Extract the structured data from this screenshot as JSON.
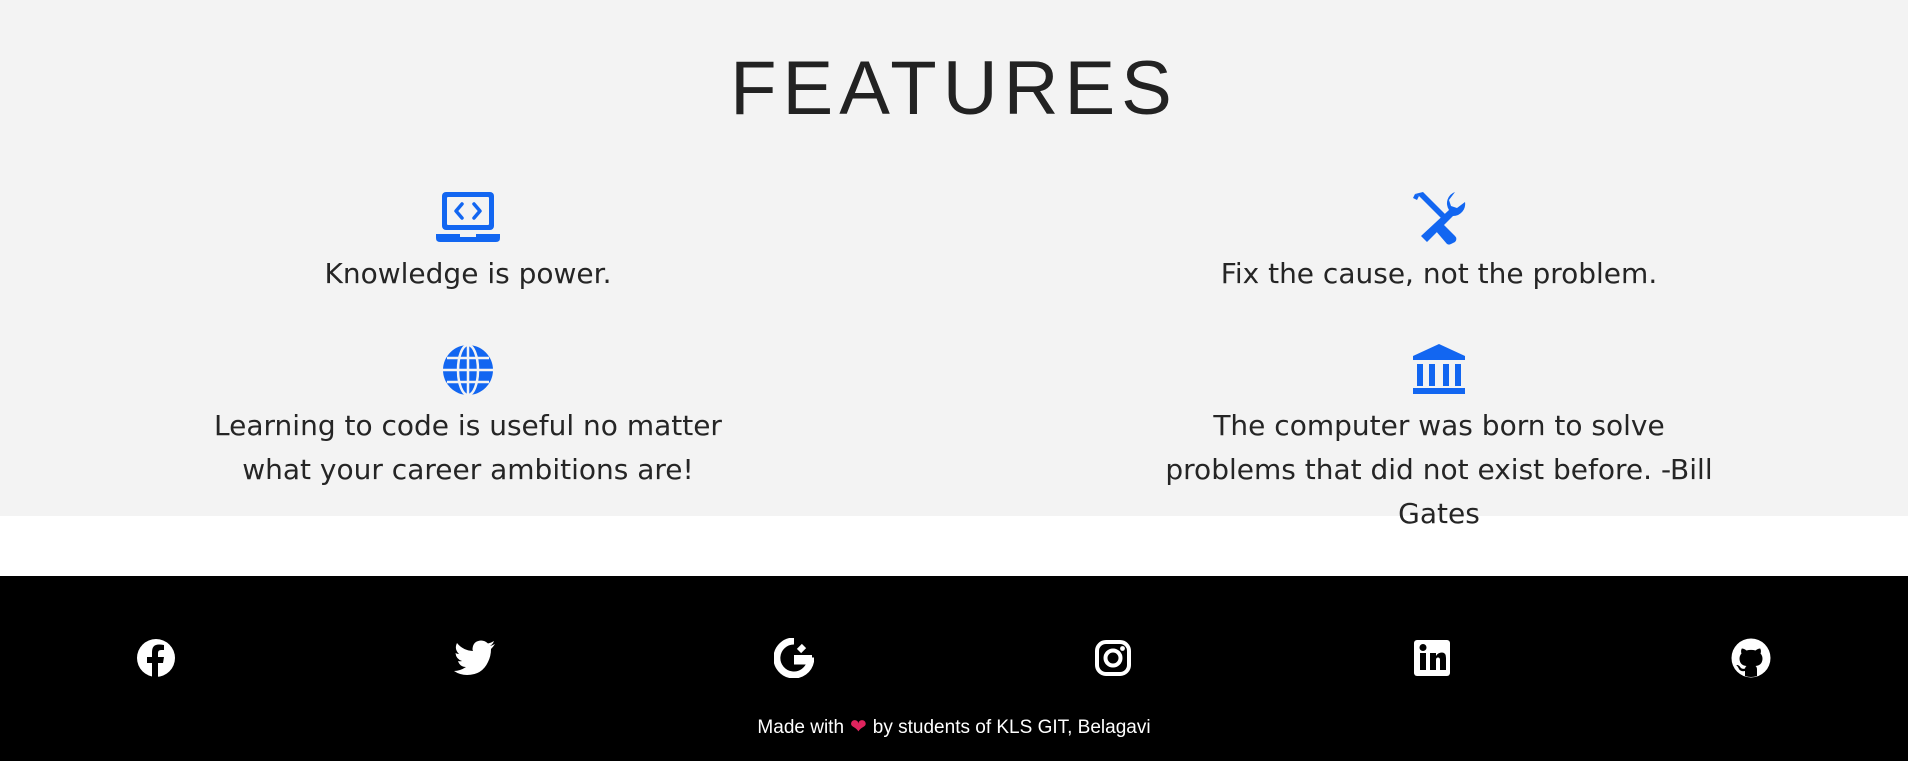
{
  "features": {
    "title": "FEATURES",
    "items": [
      {
        "icon": "laptop-code-icon",
        "text": "Knowledge is power."
      },
      {
        "icon": "tools-icon",
        "text": "Fix the cause, not the problem."
      },
      {
        "icon": "globe-icon",
        "text": "Learning to code is useful no matter what your career ambitions are!"
      },
      {
        "icon": "bank-icon",
        "text": "The computer was born to solve problems that did not exist before. -Bill Gates"
      }
    ],
    "accent_color": "#1266f1",
    "background_color": "#f3f3f3"
  },
  "footer": {
    "social": [
      "facebook-icon",
      "twitter-icon",
      "google-icon",
      "instagram-icon",
      "linkedin-icon",
      "github-icon"
    ],
    "credit_before": "Made with",
    "credit_after": "by students of KLS GIT, Belagavi",
    "heart_icon": "heart-icon",
    "background_color": "#000000"
  }
}
